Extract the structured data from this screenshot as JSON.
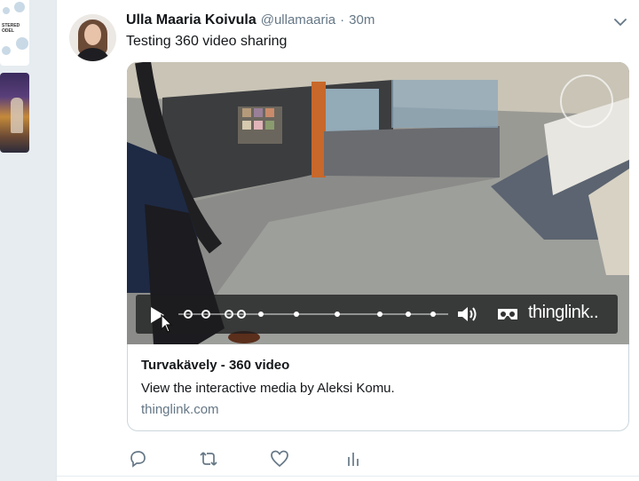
{
  "tweet": {
    "author_name": "Ulla Maaria Koivula",
    "handle": "@ullamaaria",
    "separator": "·",
    "timestamp": "30m",
    "text": "Testing 360 video sharing"
  },
  "sidebar_thumbs": {
    "thumb1_text": "STERED\nODEL"
  },
  "video": {
    "brand": "thinglink",
    "brand_suffix": "..",
    "progress_markers": 10
  },
  "link_card": {
    "title": "Turvakävely - 360 video",
    "description": "View the interactive media by Aleksi Komu.",
    "domain": "thinglink.com"
  },
  "actions": [
    "reply-icon",
    "retweet-icon",
    "like-icon",
    "analytics-icon"
  ],
  "colors": {
    "text_primary": "#14171a",
    "text_secondary": "#657786",
    "border": "#ccd6dd",
    "background": "#e6ecf0"
  }
}
